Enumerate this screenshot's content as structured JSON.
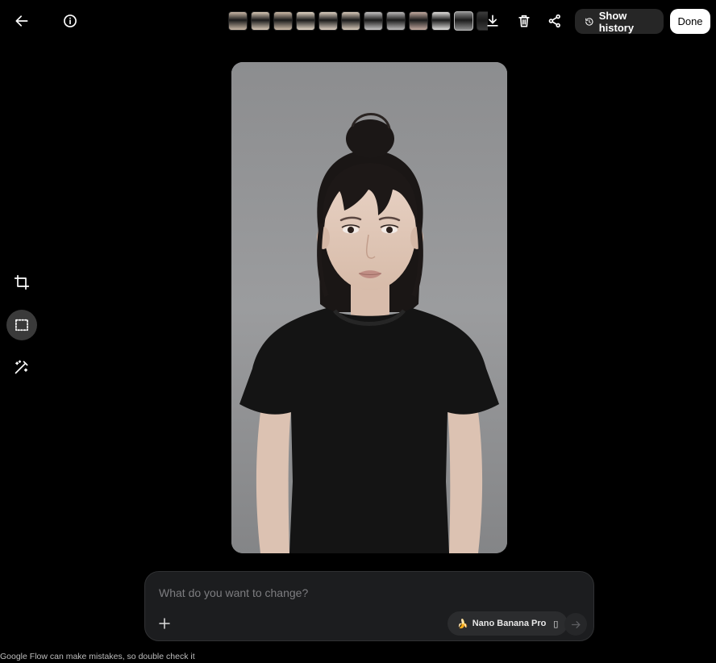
{
  "toolbar": {
    "show_history_label": "Show history",
    "done_label": "Done",
    "icons": {
      "back": "arrow-left-icon",
      "info": "info-icon",
      "download": "download-icon",
      "delete": "trash-icon",
      "share": "share-icon",
      "history": "history-icon"
    }
  },
  "thumbnails": {
    "count": 12,
    "selected_index": 10,
    "tones": [
      "#c9b7a6",
      "#d7c8b6",
      "#cdbba8",
      "#e3d6c6",
      "#ddd0c2",
      "#d9cbbb",
      "#c6c4c4",
      "#bdbbbb",
      "#c3aaa0",
      "#e2e0de",
      "#8d8d8d",
      "#3b3b3b"
    ]
  },
  "side_tools": [
    {
      "name": "crop-icon",
      "active": false
    },
    {
      "name": "select-area-icon",
      "active": true
    },
    {
      "name": "magic-edit-icon",
      "active": false
    }
  ],
  "prompt": {
    "placeholder": "What do you want to change?",
    "value": "",
    "model_label": "Nano Banana Pro",
    "model_emoji": "🍌",
    "model_suffix": "▯"
  },
  "footer": {
    "disclaimer": "Google Flow can make mistakes, so double check it"
  },
  "colors": {
    "background": "#000000",
    "panel": "#1c1d1f",
    "pill": "#262626",
    "done_bg": "#ffffff"
  }
}
